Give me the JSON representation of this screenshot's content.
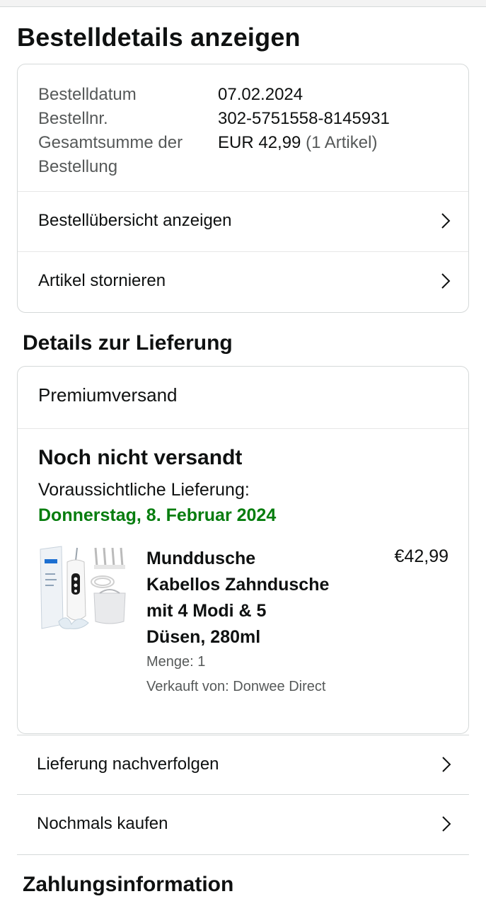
{
  "page": {
    "title": "Bestelldetails anzeigen"
  },
  "order_summary": {
    "date_label": "Bestelldatum",
    "date_value": "07.02.2024",
    "number_label": "Bestellnr.",
    "number_value": "302-5751558-8145931",
    "total_label_line1": "Gesamtsumme der",
    "total_label_line2": "Bestellung",
    "total_value": "EUR 42,99",
    "total_items": "(1 Artikel)"
  },
  "order_links": {
    "overview": "Bestellübersicht anzeigen",
    "cancel": "Artikel stornieren"
  },
  "delivery": {
    "heading": "Details zur Lieferung",
    "shipping_type": "Premiumversand",
    "status": "Noch nicht versandt",
    "expected_label": "Voraussichtliche Lieferung:",
    "expected_date": "Donnerstag, 8. Februar 2024",
    "product": {
      "title_line1": "Munddusche",
      "title_line2": "Kabellos Zahndusche",
      "title_line3": "mit 4 Modi & 5",
      "title_line4": "Düsen, 280ml",
      "price": "€42,99",
      "quantity": "Menge: 1",
      "seller": "Verkauft von: Donwee Direct"
    }
  },
  "actions": {
    "track": "Lieferung nachverfolgen",
    "buy_again": "Nochmals kaufen"
  },
  "payment": {
    "heading": "Zahlungsinformation"
  },
  "colors": {
    "delivery_date": "#067d0e",
    "border": "#d5d9d9",
    "muted": "#565959"
  },
  "icons": {
    "row_chevron": "chevron-right-icon",
    "product_image": "water-flosser-product-image"
  }
}
